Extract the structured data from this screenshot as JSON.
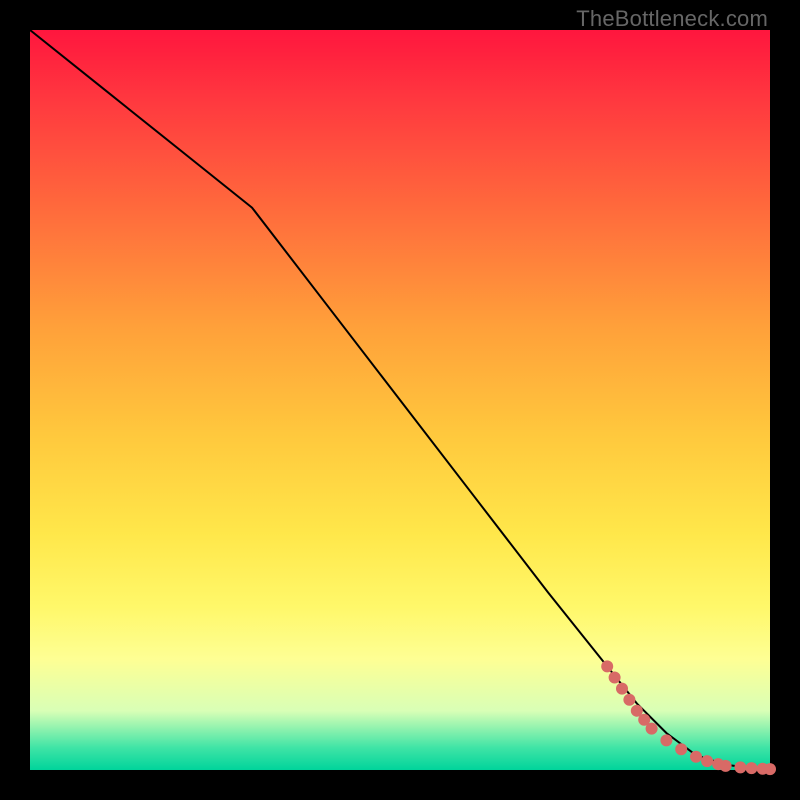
{
  "watermark": "TheBottleneck.com",
  "colors": {
    "curve": "#000000",
    "dot": "#d86a66"
  },
  "chart_data": {
    "type": "line",
    "title": "",
    "xlabel": "",
    "ylabel": "",
    "xlim": [
      0,
      100
    ],
    "ylim": [
      0,
      100
    ],
    "grid": false,
    "series": [
      {
        "name": "curve",
        "x": [
          0,
          10,
          20,
          30,
          40,
          50,
          60,
          70,
          78,
          82,
          86,
          90,
          94,
          98,
          100
        ],
        "y": [
          100,
          92,
          84,
          76,
          63,
          50,
          37,
          24,
          14,
          9,
          5,
          2,
          0.7,
          0.2,
          0.1
        ]
      }
    ],
    "points": {
      "name": "dots",
      "x": [
        78,
        79,
        80,
        81,
        82,
        83,
        84,
        86,
        88,
        90,
        91.5,
        93,
        94,
        96,
        97.5,
        99,
        100
      ],
      "y": [
        14,
        12.5,
        11,
        9.5,
        8,
        6.8,
        5.6,
        4,
        2.8,
        1.8,
        1.2,
        0.8,
        0.55,
        0.35,
        0.25,
        0.18,
        0.12
      ]
    }
  }
}
